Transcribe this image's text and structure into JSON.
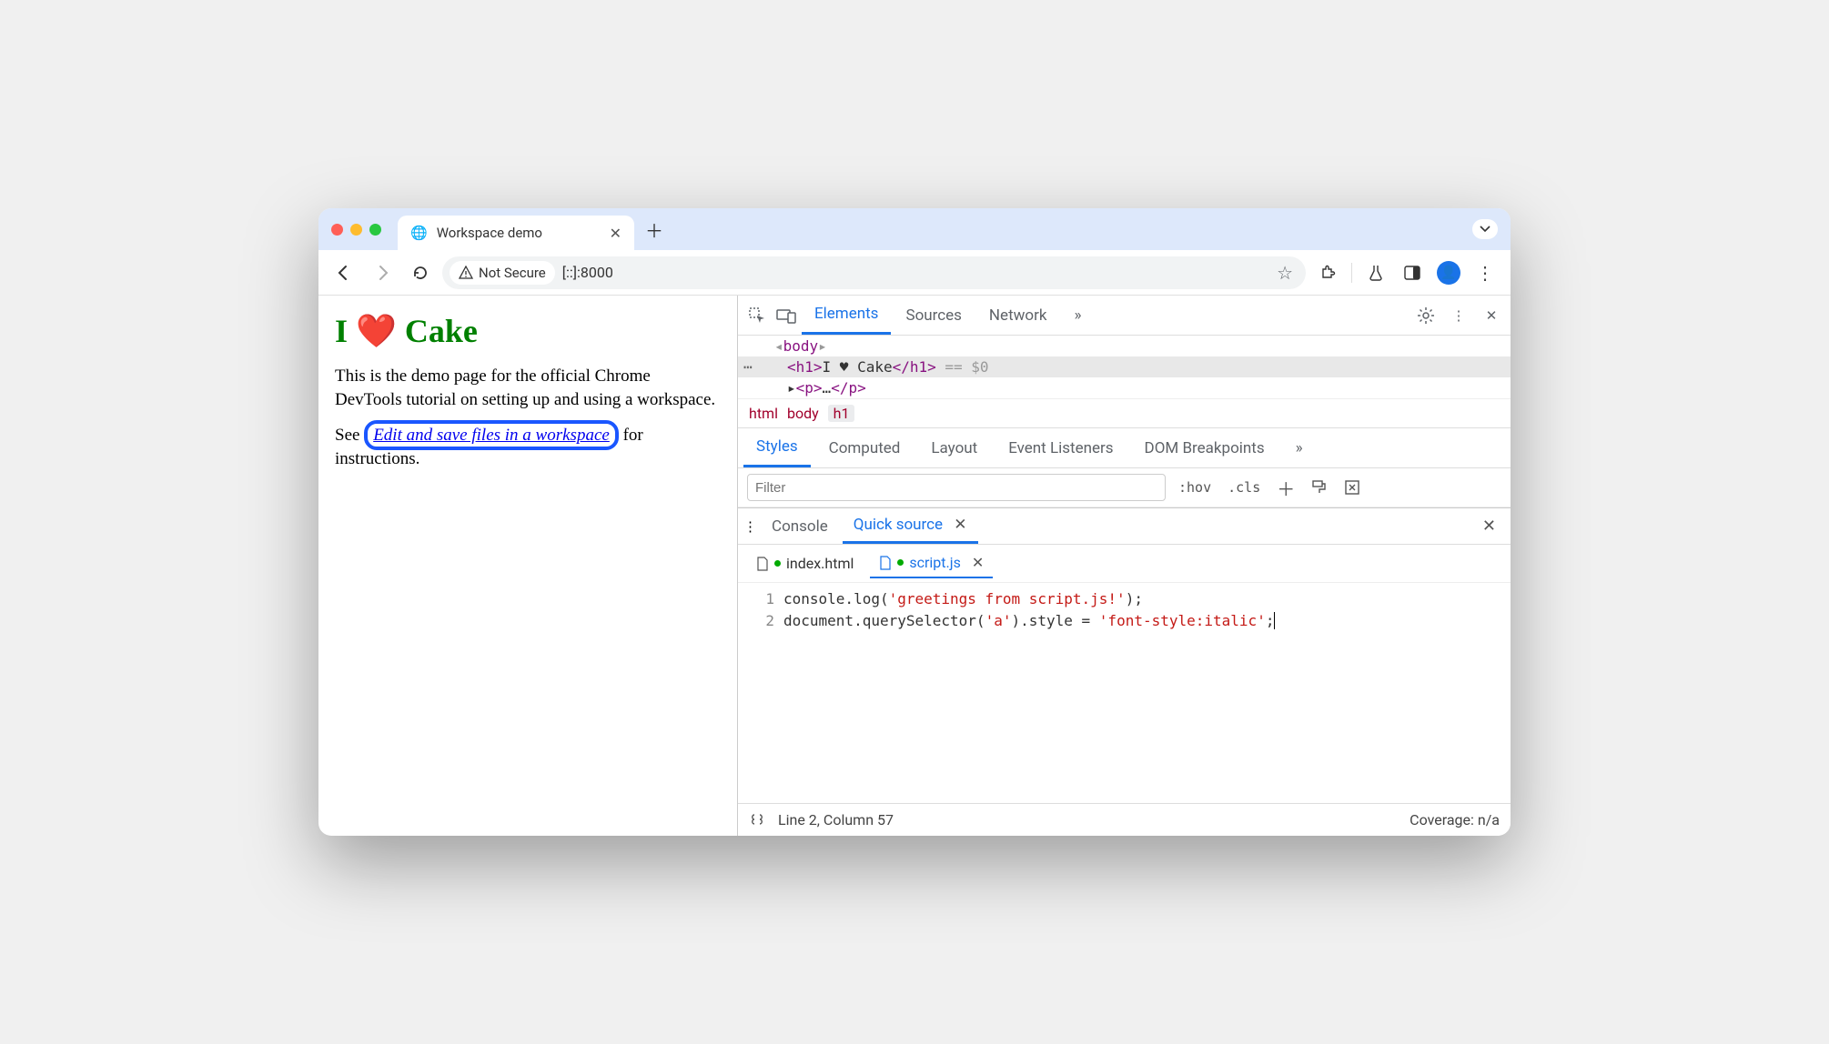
{
  "browser": {
    "tab_title": "Workspace demo",
    "security_label": "Not Secure",
    "address": "[::]:8000"
  },
  "page": {
    "heading": "I ❤️ Cake",
    "para1": "This is the demo page for the official Chrome DevTools tutorial on setting up and using a workspace.",
    "para2_pre": "See ",
    "link_text": "Edit and save files in a workspace",
    "para2_post": " for instructions."
  },
  "devtools": {
    "tabs": {
      "elements": "Elements",
      "sources": "Sources",
      "network": "Network"
    },
    "dom": {
      "body_open": "<body>",
      "h1_open": "<h1>",
      "h1_text": "I ♥ Cake",
      "h1_close": "</h1>",
      "selected_suffix": " == $0",
      "p_stub": "<p>…</p>"
    },
    "crumbs": [
      "html",
      "body",
      "h1"
    ],
    "styles_tabs": {
      "styles": "Styles",
      "computed": "Computed",
      "layout": "Layout",
      "event_listeners": "Event Listeners",
      "dom_breakpoints": "DOM Breakpoints"
    },
    "styles_filter_placeholder": "Filter",
    "styles_tools": {
      "hov": ":hov",
      "cls": ".cls"
    },
    "drawer_tabs": {
      "console": "Console",
      "quick_source": "Quick source"
    },
    "files": {
      "index": "index.html",
      "script": "script.js"
    },
    "code": {
      "line1": "console.log('greetings from script.js!');",
      "line2": "document.querySelector('a').style = 'font-style:italic';"
    },
    "status": {
      "pos": "Line 2, Column 57",
      "coverage": "Coverage: n/a"
    }
  }
}
